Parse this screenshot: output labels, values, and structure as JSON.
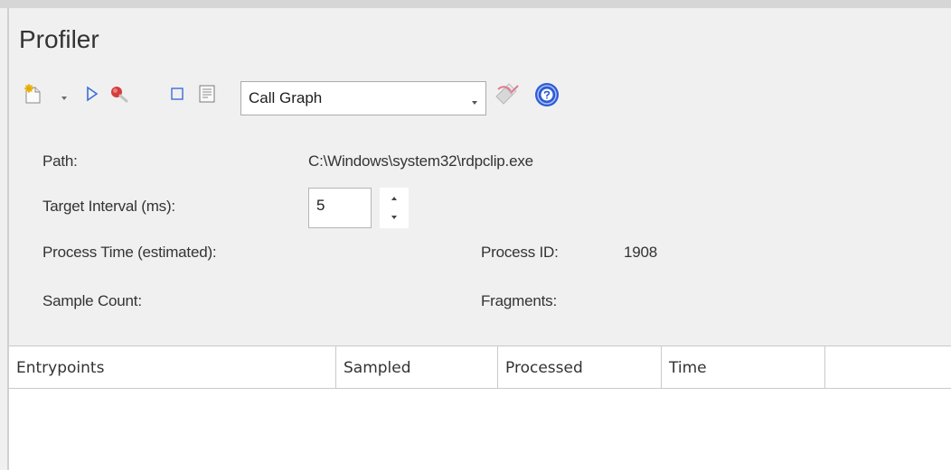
{
  "window": {
    "title": "Profiler"
  },
  "toolbar": {
    "view_selected": "Call Graph",
    "icons": {
      "new": "new-document-icon",
      "dropdown": "chevron-down-icon",
      "run": "play-icon",
      "search": "search-icon",
      "stop": "stop-icon",
      "report": "report-icon",
      "eraser": "eraser-icon",
      "help": "help-icon"
    }
  },
  "form": {
    "path_label": "Path:",
    "path_value": "C:\\Windows\\system32\\rdpclip.exe",
    "interval_label": "Target Interval (ms):",
    "interval_value": "5",
    "process_time_label": "Process Time (estimated):",
    "process_id_label": "Process ID:",
    "process_id_value": "1908",
    "sample_count_label": "Sample Count:",
    "fragments_label": "Fragments:"
  },
  "table": {
    "columns": [
      "Entrypoints",
      "Sampled",
      "Processed",
      "Time"
    ],
    "rows": []
  },
  "colors": {
    "accent_blue": "#3a6fd8",
    "help_blue": "#2d5bd6",
    "search_red": "#d63c3c",
    "background": "#f0f0f0"
  }
}
